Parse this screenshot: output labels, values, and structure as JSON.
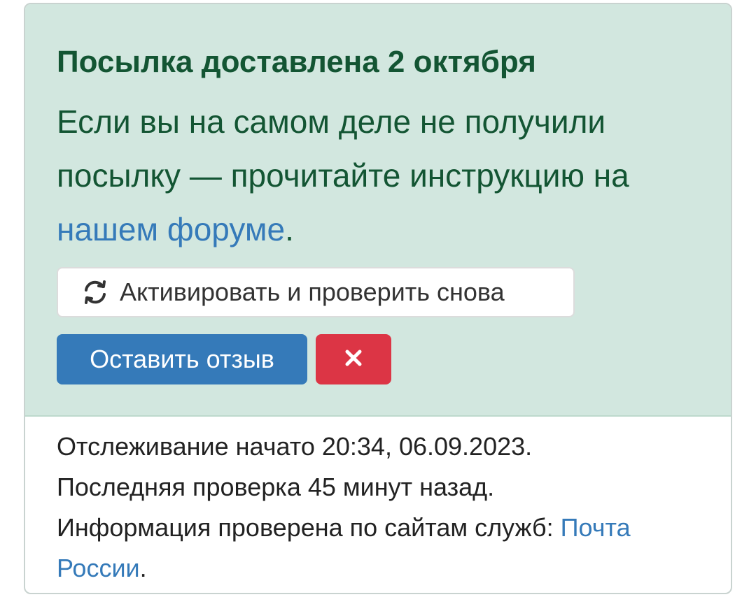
{
  "alert": {
    "title": "Посылка доставлена 2 октября",
    "text_before": "Если вы на самом деле не получили посылку — прочитайте инструкцию на ",
    "link_text": "нашем форуме",
    "text_after": "."
  },
  "buttons": {
    "refresh_icon": "refresh-icon",
    "refresh_label": "Активировать и проверить снова",
    "review_label": "Оставить отзыв",
    "close_icon": "close-icon"
  },
  "info": {
    "tracking_started": "Отслеживание начато 20:34, 06.09.2023.",
    "last_check": "Последняя проверка 45 минут назад.",
    "sources_prefix": "Информация проверена по сайтам служб: ",
    "sources_link": "Почта России",
    "sources_suffix": "."
  },
  "colors": {
    "alert_bg": "#d2e7df",
    "alert_text": "#135533",
    "link": "#357ab9",
    "primary_button": "#357ab9",
    "danger_button": "#dc3545"
  }
}
